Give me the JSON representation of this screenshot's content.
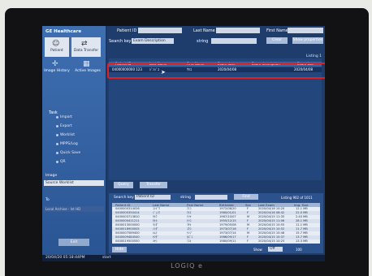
{
  "app": {
    "logo": "GE Healthcare"
  },
  "nav": {
    "patient": "Patient",
    "data_transfer": "Data Transfer",
    "image_history": "Image History",
    "active_images": "Active Images"
  },
  "tasks": {
    "title": "Task",
    "items": [
      "Import",
      "Export",
      "Worklist",
      "MPPS/Log",
      "Quick Save",
      "QR"
    ]
  },
  "worklist_section": {
    "label": "Image",
    "selected": "Source Worklist"
  },
  "location_section": {
    "label": "To",
    "selected": "Local Archive - Int HD"
  },
  "exit_label": "Exit",
  "search": {
    "patient_id_label": "Patient ID",
    "last_name_label": "Last Name",
    "first_name_label": "First Name",
    "search_key_label": "Search key",
    "search_key_value": "Exam Description",
    "string_label": "string",
    "clear_label": "Clear",
    "show_properties_label": "Show properties",
    "listing": "Listing 1"
  },
  "upper_table": {
    "headers": [
      "Patient ID",
      "Last Name",
      "First Name",
      "Exam date",
      "Exam description",
      "Exam Loc."
    ],
    "selected_row": [
      "04000000000 123",
      "ｼﾞﾝｼﾞﾕ",
      "ｻｷｺ",
      "2020/04/08",
      "",
      "2020/04/08"
    ]
  },
  "lower_controls": {
    "query_label": "Query",
    "transfer_label": "Transfer",
    "search_key_label": "Search key",
    "search_key_value": "Patient ID",
    "string_label": "string",
    "find_label": "Find",
    "listing": "Listing 902 of 1011"
  },
  "lower_table": {
    "headers": [
      "Patient ID",
      "Last Name",
      "First Name",
      "Birthdate",
      "Sex",
      "Last Exam",
      "Img. Size"
    ],
    "rows": [
      [
        "0400000314026",
        "ｺﾝﾄﾞｳ",
        "ﾏﾐｺ",
        "1972/08/20",
        "F",
        "2020/04/16 10:20",
        "12.1 MB"
      ],
      [
        "0400000350414",
        "ｼﾞｭﾝｳ",
        "ｱｷｴ",
        "1980/01/01",
        "F",
        "2020/04/16 08:42",
        "22.0 MB"
      ],
      [
        "0400003713810",
        "ｻﾄｳ",
        "ﾃﾂﾔ",
        "1967/10/07",
        "M",
        "2020/04/15 11:35",
        "2.40 MB"
      ],
      [
        "0400000411211",
        "ﾀﾅｶ",
        "ﾅﾂｺ",
        "1955/12/15",
        "F",
        "2020/04/15 11:06",
        "28.1 MB"
      ],
      [
        "0400013000000",
        "ﾖｼﾀﾞ",
        "ﾏｻｷ",
        "1979/05/08",
        "M",
        "2020/04/15 10:55",
        "11.1 MB"
      ],
      [
        "0400018900005",
        "ｲｼﾀﾞ",
        "ﾕｳｺ",
        "1973/07/16",
        "F",
        "2020/04/15 10:52",
        "11.7 MB"
      ],
      [
        "0400007589400",
        "ｷﾑﾗ",
        "ｹﾝｼﾞ",
        "1973/07/14",
        "M",
        "2020/04/15 10:48",
        "15.7 MB"
      ],
      [
        "0400009484540",
        "ﾔﾏﾀﾞ",
        "ｶｽﾞｺ",
        "1986/09/17",
        "F",
        "2020/04/15 10:37",
        "13.7 MB"
      ],
      [
        "0400019500550",
        "ﾊﾔｼ",
        "ﾐﾕｷ",
        "1980/09/11",
        "F",
        "2020/04/15 10:25",
        "13.3 MB"
      ]
    ]
  },
  "lower_footer": {
    "hide_label": "Hide",
    "show_label": "Show",
    "all_label": "Off",
    "page": "100"
  },
  "taskbar": {
    "datetime": "20/04/20 05:18:44PM",
    "start_label": "start"
  },
  "device_label": "LOGIQ e"
}
